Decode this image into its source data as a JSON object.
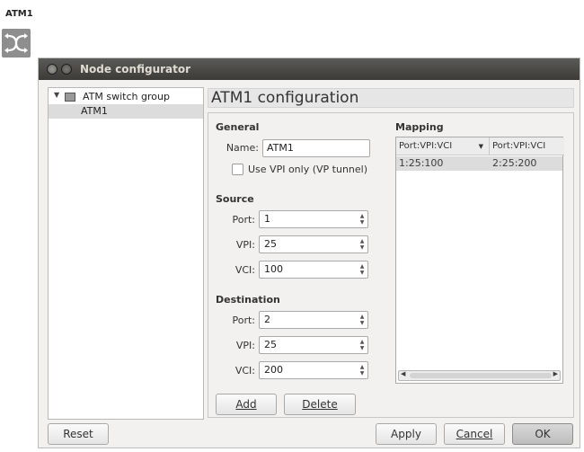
{
  "canvas": {
    "node_label": "ATM1",
    "node_icon": "atm-switch-icon"
  },
  "dialog": {
    "title": "Node configurator",
    "window_buttons": [
      "close-icon",
      "minimize-icon"
    ],
    "tree": {
      "group_label": "ATM switch group",
      "child_label": "ATM1"
    },
    "config_title": "ATM1 configuration",
    "general": {
      "heading": "General",
      "name_label": "Name:",
      "name_value": "ATM1",
      "vpi_only_label": "Use VPI only (VP tunnel)",
      "vpi_only_checked": false
    },
    "source": {
      "heading": "Source",
      "port_label": "Port:",
      "port_value": "1",
      "vpi_label": "VPI:",
      "vpi_value": "25",
      "vci_label": "VCI:",
      "vci_value": "100"
    },
    "destination": {
      "heading": "Destination",
      "port_label": "Port:",
      "port_value": "2",
      "vpi_label": "VPI:",
      "vpi_value": "25",
      "vci_label": "VCI:",
      "vci_value": "200"
    },
    "mapping": {
      "heading": "Mapping",
      "columns": [
        "Port:VPI:VCI",
        "Port:VPI:VCI"
      ],
      "rows": [
        [
          "1:25:100",
          "2:25:200"
        ]
      ]
    },
    "buttons": {
      "add": "Add",
      "delete": "Delete",
      "reset": "Reset",
      "apply": "Apply",
      "cancel": "Cancel",
      "ok": "OK"
    },
    "colors": {
      "titlebar": "#3c3b37",
      "window_bg": "#f2f1f0",
      "selection": "#dcdcdc"
    }
  }
}
